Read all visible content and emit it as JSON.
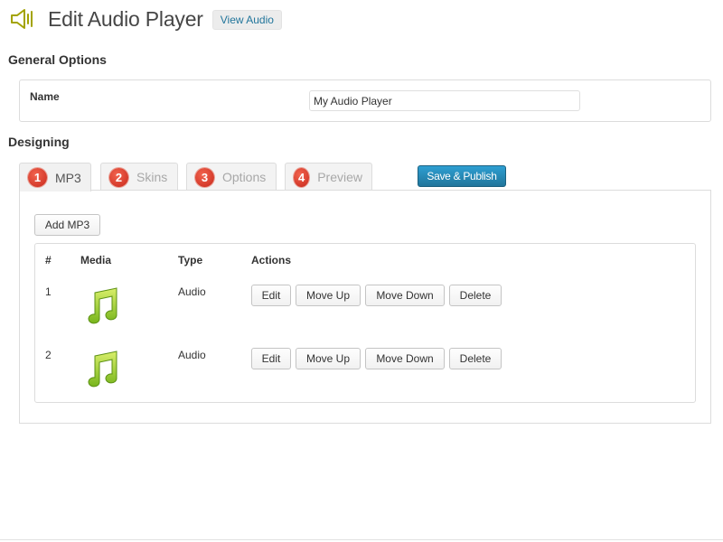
{
  "header": {
    "icon": "speaker-icon",
    "icon_color": "#9a9a00",
    "title": "Edit Audio Player",
    "view_label": "View Audio"
  },
  "general": {
    "heading": "General Options",
    "name_label": "Name",
    "name_value": "My Audio Player"
  },
  "designing": {
    "heading": "Designing",
    "tabs": [
      {
        "num": "1",
        "label": "MP3",
        "active": true
      },
      {
        "num": "2",
        "label": "Skins",
        "active": false
      },
      {
        "num": "3",
        "label": "Options",
        "active": false
      },
      {
        "num": "4",
        "label": "Preview",
        "active": false
      }
    ],
    "publish_label": "Save & Publish",
    "accent_color": "#21759b",
    "badge_color": "#d9321f",
    "add_label": "Add MP3",
    "table": {
      "headers": [
        "#",
        "Media",
        "Type",
        "Actions"
      ],
      "rows": [
        {
          "num": "1",
          "media_icon": "music-note-icon",
          "type": "Audio"
        },
        {
          "num": "2",
          "media_icon": "music-note-icon",
          "type": "Audio"
        }
      ],
      "actions": {
        "edit": "Edit",
        "move_up": "Move Up",
        "move_down": "Move Down",
        "delete": "Delete"
      }
    }
  }
}
